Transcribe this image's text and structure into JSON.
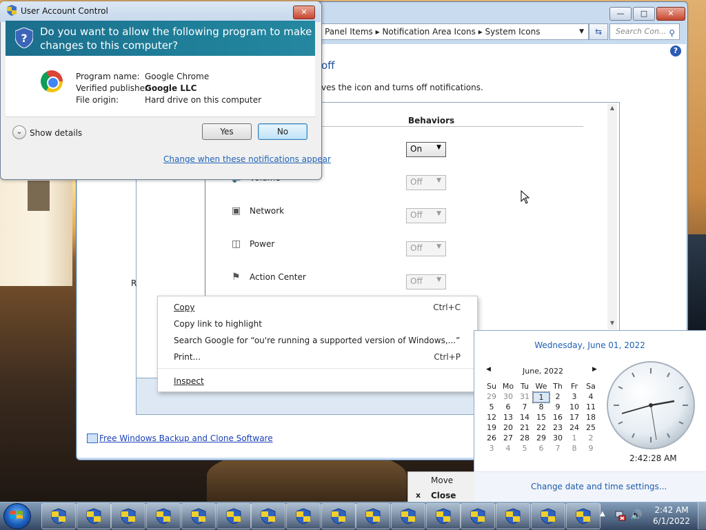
{
  "background_window": {
    "breadcrumb": [
      "Panel Items",
      "Notification Area Icons",
      "System Icons"
    ],
    "search_placeholder": "Search Con...",
    "heading": "off",
    "description": "ves the icon and turns off notifications.",
    "behaviors_header": "Behaviors",
    "system_icons": [
      {
        "name": "Volume",
        "behavior": "Off",
        "icon": "speaker-icon"
      },
      {
        "name": "Network",
        "behavior": "Off",
        "icon": "network-icon"
      },
      {
        "name": "Power",
        "behavior": "Off",
        "icon": "power-icon"
      },
      {
        "name": "Action Center",
        "behavior": "Off",
        "icon": "flag-icon"
      }
    ],
    "first_behavior": "On",
    "stray_letter": "R",
    "backup_link": "Free Windows Backup and Clone Software"
  },
  "uac": {
    "title": "User Account Control",
    "question": "Do you want to allow the following program to make changes to this computer?",
    "program_name_label": "Program name:",
    "program_name": "Google Chrome",
    "publisher_label": "Verified publisher:",
    "publisher": "Google LLC",
    "origin_label": "File origin:",
    "origin": "Hard drive on this computer",
    "show_details": "Show details",
    "yes": "Yes",
    "no": "No",
    "notify_link": "Change when these notifications appear"
  },
  "context_menu": {
    "copy": "Copy",
    "copy_shortcut": "Ctrl+C",
    "copy_link": "Copy link to highlight",
    "search_google": "Search Google for “ou're running a supported version of Windows,...”",
    "print": "Print...",
    "print_shortcut": "Ctrl+P",
    "inspect": "Inspect"
  },
  "clock_flyout": {
    "long_date": "Wednesday, June 01, 2022",
    "month": "June, 2022",
    "weekdays": [
      "Su",
      "Mo",
      "Tu",
      "We",
      "Th",
      "Fr",
      "Sa"
    ],
    "weeks": [
      [
        "29",
        "30",
        "31",
        "1",
        "2",
        "3",
        "4"
      ],
      [
        "5",
        "6",
        "7",
        "8",
        "9",
        "10",
        "11"
      ],
      [
        "12",
        "13",
        "14",
        "15",
        "16",
        "17",
        "18"
      ],
      [
        "19",
        "20",
        "21",
        "22",
        "23",
        "24",
        "25"
      ],
      [
        "26",
        "27",
        "28",
        "29",
        "30",
        "1",
        "2"
      ],
      [
        "3",
        "4",
        "5",
        "6",
        "7",
        "8",
        "9"
      ]
    ],
    "time": "2:42:28 AM",
    "settings_link": "Change date and time settings..."
  },
  "system_menu": {
    "move": "Move",
    "close": "Close",
    "close_marker": "x"
  },
  "taskbar": {
    "clock_time": "2:42 AM",
    "clock_date": "6/1/2022",
    "task_button_count": 16
  },
  "colors": {
    "uac_banner": "#1f7f99",
    "link": "#1f63b8",
    "taskbar": "#2c4a70"
  }
}
